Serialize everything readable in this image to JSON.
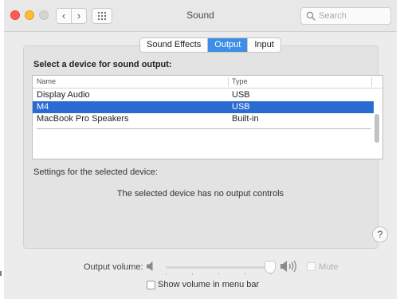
{
  "window": {
    "title": "Sound",
    "search_placeholder": "Search",
    "nav_back": "‹",
    "nav_forward": "›"
  },
  "tabs": [
    {
      "label": "Sound Effects",
      "active": false
    },
    {
      "label": "Output",
      "active": true
    },
    {
      "label": "Input",
      "active": false
    }
  ],
  "output": {
    "section_title": "Select a device for sound output:",
    "columns": {
      "name": "Name",
      "type": "Type"
    },
    "devices": [
      {
        "name": "Display Audio",
        "type": "USB",
        "selected": false
      },
      {
        "name": "M4",
        "type": "USB",
        "selected": true
      },
      {
        "name": "MacBook Pro Speakers",
        "type": "Built-in",
        "selected": false
      }
    ],
    "settings_label": "Settings for the selected device:",
    "no_controls_text": "The selected device has no output controls"
  },
  "help_label": "?",
  "volume": {
    "label": "Output volume:",
    "level_percent": 100,
    "mute_label": "Mute",
    "mute_enabled": false,
    "mute_checked": false
  },
  "menubar": {
    "label": "Show volume in menu bar",
    "checked": false
  },
  "colors": {
    "selection": "#2a6bd2",
    "active_tab": "#3c8fe5",
    "close": "#fc5f57",
    "minimize": "#fdbd2e"
  }
}
